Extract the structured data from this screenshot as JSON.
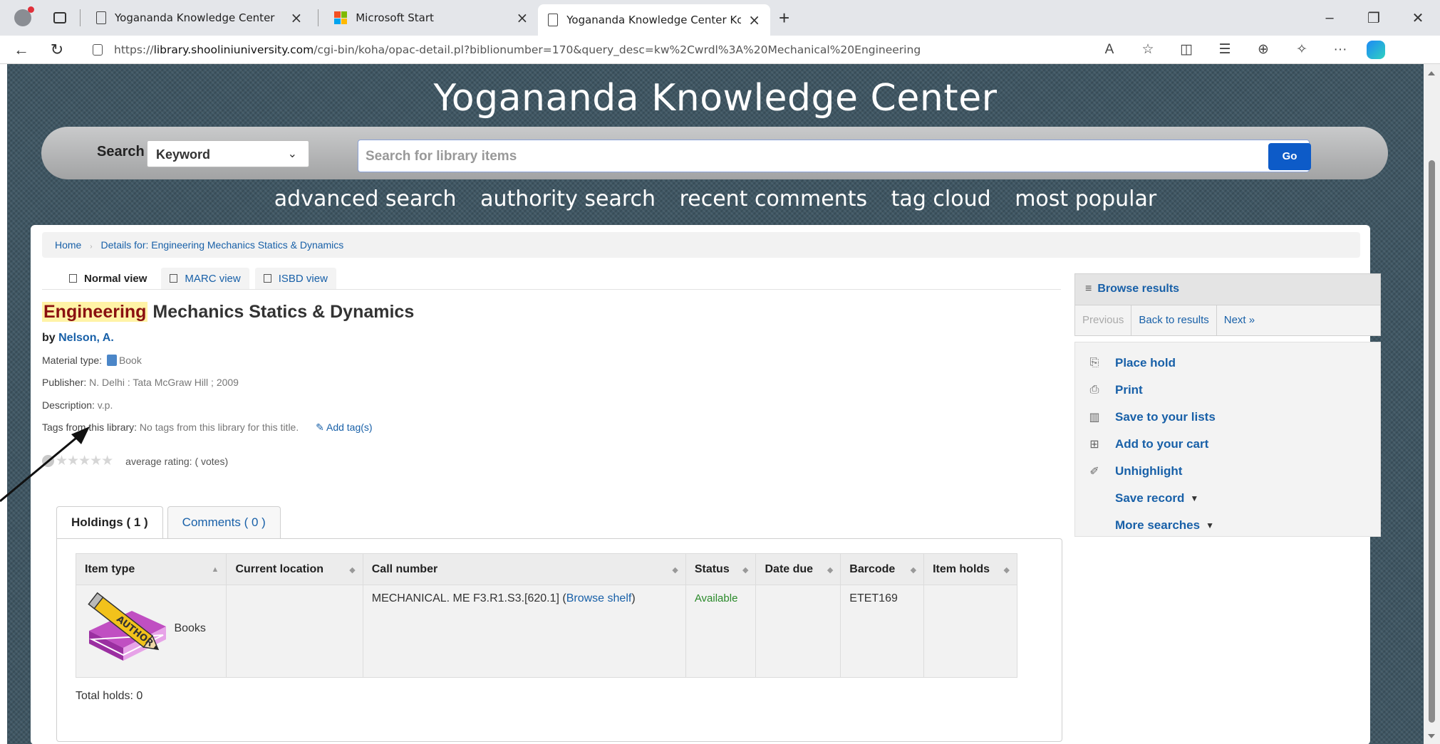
{
  "browser": {
    "tabs": [
      {
        "label": "Yogananda Knowledge Center",
        "active": false
      },
      {
        "label": "Microsoft Start",
        "active": false
      },
      {
        "label": "Yogananda Knowledge Center Kc",
        "active": true
      }
    ],
    "url_prefix": "https://",
    "url_host": "library.shooliniuniversity.com",
    "url_path": "/cgi-bin/koha/opac-detail.pl?biblionumber=170&query_desc=kw%2Cwrdl%3A%20Mechanical%20Engineering"
  },
  "site": {
    "title": "Yogananda Knowledge Center",
    "search_label": "Search",
    "search_type": "Keyword",
    "search_placeholder": "Search for library items",
    "go_label": "Go",
    "links": [
      "advanced search",
      "authority search",
      "recent comments",
      "tag cloud",
      "most popular"
    ]
  },
  "breadcrumb": {
    "home": "Home",
    "current": "Details for: Engineering Mechanics Statics & Dynamics"
  },
  "view_tabs": [
    "Normal view",
    "MARC view",
    "ISBD view"
  ],
  "record": {
    "title_highlight": "Engineering",
    "title_rest": " Mechanics Statics & Dynamics",
    "by": "by ",
    "author": "Nelson, A.",
    "material_label": "Material type:",
    "material_value": "Book",
    "publisher_label": "Publisher:",
    "publisher_value": " N. Delhi : Tata McGraw Hill ; 2009",
    "description_label": "Description:",
    "description_value": " v.p.",
    "tags_label": "Tags from this library:",
    "tags_value": " No tags from this library for this title.",
    "add_tag": "Add tag(s)",
    "rating_text": "average rating: ( votes)"
  },
  "holdings": {
    "tab_holdings": "Holdings ( 1 )",
    "tab_comments": "Comments ( 0 )",
    "columns": [
      "Item type",
      "Current location",
      "Call number",
      "Status",
      "Date due",
      "Barcode",
      "Item holds"
    ],
    "row": {
      "item_type": "Books",
      "current_location": "",
      "call_number": "MECHANICAL. ME F3.R1.S3.[620.1] (",
      "browse_shelf": "Browse shelf",
      "call_close": ")",
      "status": "Available",
      "date_due": "",
      "barcode": "ETET169",
      "item_holds": ""
    },
    "total_holds": "Total holds: 0",
    "image_word": "AUTHOR"
  },
  "sidebar": {
    "browse_results": "Browse results",
    "previous": "Previous",
    "back": "Back to results",
    "next": "Next »",
    "actions": [
      "Place hold",
      "Print",
      "Save to your lists",
      "Add to your cart",
      "Unhighlight",
      "Save record",
      "More searches"
    ]
  }
}
